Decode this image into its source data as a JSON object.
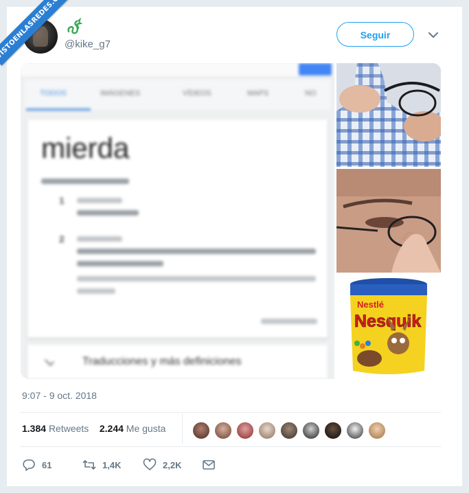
{
  "watermark": "VISTOENLASREDES.COM",
  "user": {
    "handle": "@kike_g7"
  },
  "follow_button": "Seguir",
  "screenshot": {
    "tabs": [
      "TODOS",
      "IMÁGENES",
      "VÍDEOS",
      "MAPS",
      "NO"
    ],
    "headword": "mierda",
    "footer": "Traducciones y más definiciones"
  },
  "product": {
    "brand": "Nestlé",
    "name": "Nesquik"
  },
  "timestamp": "9:07 - 9 oct. 2018",
  "stats": {
    "retweets_count": "1.384",
    "retweets_label": "Retweets",
    "likes_count": "2.244",
    "likes_label": "Me gusta"
  },
  "actions": {
    "replies": "61",
    "retweets": "1,4K",
    "likes": "2,2K"
  },
  "colors": {
    "accent": "#1da1f2",
    "ribbon": "#2a7fd4",
    "muted": "#657786"
  }
}
